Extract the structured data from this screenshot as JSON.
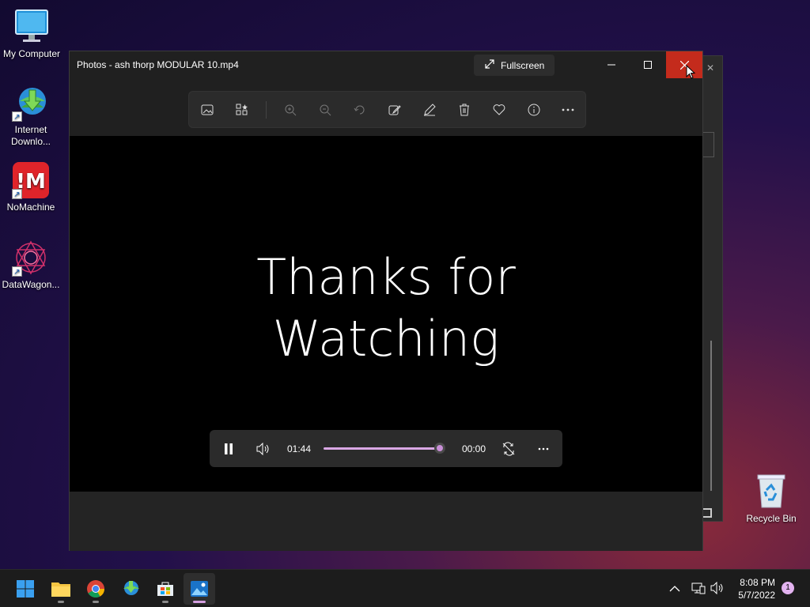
{
  "desktop": {
    "icons": [
      {
        "label": "My Computer",
        "icon": "monitor-icon"
      },
      {
        "label": "Internet Downlo...",
        "label_line1": "Internet",
        "label_line2": "Downlo...",
        "icon": "idm-icon"
      },
      {
        "label": "NoMachine",
        "icon": "nomachine-icon"
      },
      {
        "label": "DataWagon...",
        "icon": "datawagon-icon"
      }
    ],
    "recycle_bin": {
      "label": "Recycle Bin",
      "icon": "recycle-bin-icon"
    }
  },
  "window": {
    "title": "Photos - ash thorp MODULAR 10.mp4",
    "fullscreen_label": "Fullscreen",
    "controls": {
      "minimize": "minimize-icon",
      "maximize": "maximize-icon",
      "close": "close-icon"
    },
    "toolbar": [
      "gallery-icon",
      "filmstrip-icon",
      "zoom-in-icon",
      "zoom-out-icon",
      "rotate-icon",
      "edit-image-icon",
      "draw-icon",
      "delete-icon",
      "favorite-icon",
      "info-icon",
      "more-icon"
    ],
    "caption_line1": "Thanks for",
    "caption_line2": "Watching",
    "player": {
      "elapsed": "01:44",
      "remaining": "00:00",
      "progress": 0.95
    }
  },
  "taskbar": {
    "apps": [
      "windows-start-icon",
      "file-explorer-icon",
      "chrome-icon",
      "idm-icon",
      "store-icon",
      "photos-icon"
    ],
    "time": "8:08 PM",
    "date": "5/7/2022",
    "notifications": "1"
  },
  "colors": {
    "close_red": "#c42b1c",
    "accent_pink": "#d49fe0",
    "window_bg": "#202020"
  }
}
